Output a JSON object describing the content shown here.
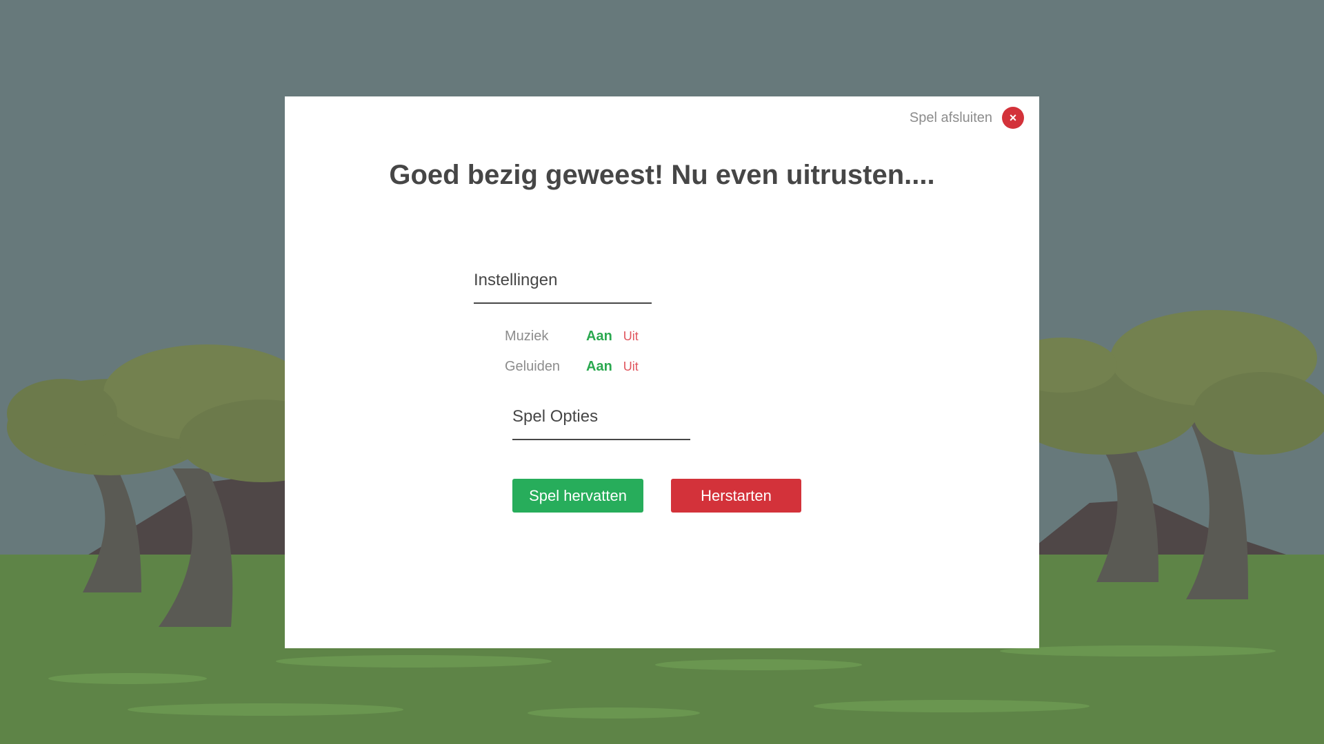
{
  "scene": {
    "sky_color": "#67797b",
    "ground_color": "#5e8447"
  },
  "dialog": {
    "close_label": "Spel afsluiten",
    "close_icon": "×",
    "title": "Goed bezig geweest! Nu even uitrusten....",
    "settings": {
      "heading": "Instellingen",
      "rows": [
        {
          "label": "Muziek",
          "on": "Aan",
          "off": "Uit"
        },
        {
          "label": "Geluiden",
          "on": "Aan",
          "off": "Uit"
        }
      ]
    },
    "options": {
      "heading": "Spel Opties",
      "resume_label": "Spel hervatten",
      "restart_label": "Herstarten"
    },
    "colors": {
      "accent_green": "#27ad5b",
      "accent_red": "#d3323a"
    }
  }
}
